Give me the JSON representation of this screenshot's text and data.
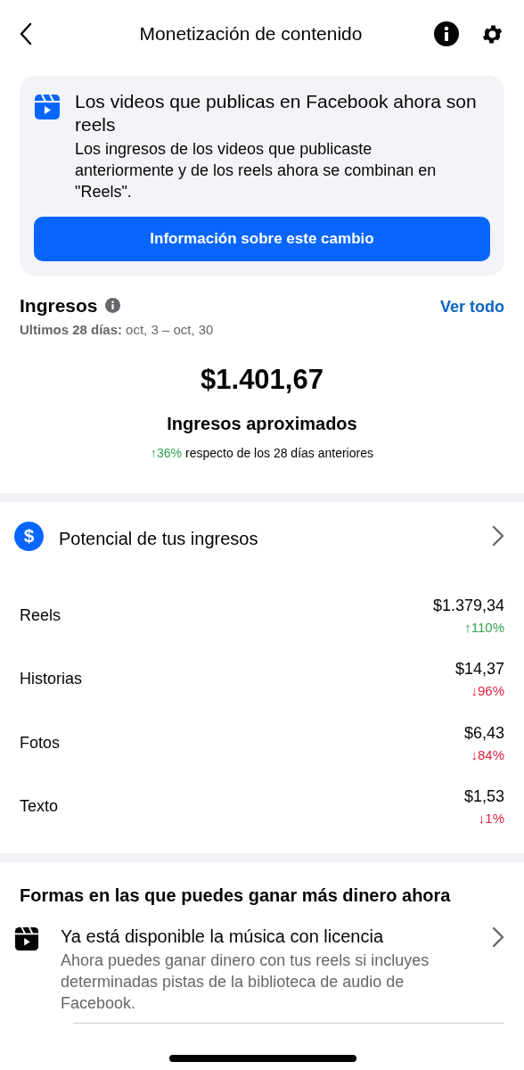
{
  "header": {
    "title": "Monetización de contenido"
  },
  "notice": {
    "title": "Los videos que publicas en Facebook ahora son reels",
    "body": "Los ingresos de los videos que publicaste anteriormente y de los reels ahora se combinan en \"Reels\".",
    "button": "Información sobre este cambio"
  },
  "earnings": {
    "title": "Ingresos",
    "link": "Ver todo",
    "period_label": "Ultimos 28 días:",
    "period": "oct, 3 – oct, 30",
    "amount": "$1.401,67",
    "amount_label": "Ingresos aproximados",
    "change": {
      "text": "↑36%",
      "kind": "up"
    },
    "change_text": "respecto de los 28 días anteriores"
  },
  "potential": {
    "label": "Potencial de tus ingresos",
    "icon_text": "$"
  },
  "breakdown": [
    {
      "label": "Reels",
      "amount": "$1.379,34",
      "change": "↑110%",
      "kind": "up"
    },
    {
      "label": "Historias",
      "amount": "$14,37",
      "change": "↓96%",
      "kind": "down"
    },
    {
      "label": "Fotos",
      "amount": "$6,43",
      "change": "↓84%",
      "kind": "down"
    },
    {
      "label": "Texto",
      "amount": "$1,53",
      "change": "↓1%",
      "kind": "down"
    }
  ],
  "ways": {
    "title": "Formas en las que puedes ganar más dinero ahora",
    "items": [
      {
        "title": "Ya está disponible la música con licencia",
        "body": "Ahora puedes ganar dinero con tus reels si incluyes determinadas pistas de la biblioteca de audio de Facebook."
      }
    ]
  }
}
